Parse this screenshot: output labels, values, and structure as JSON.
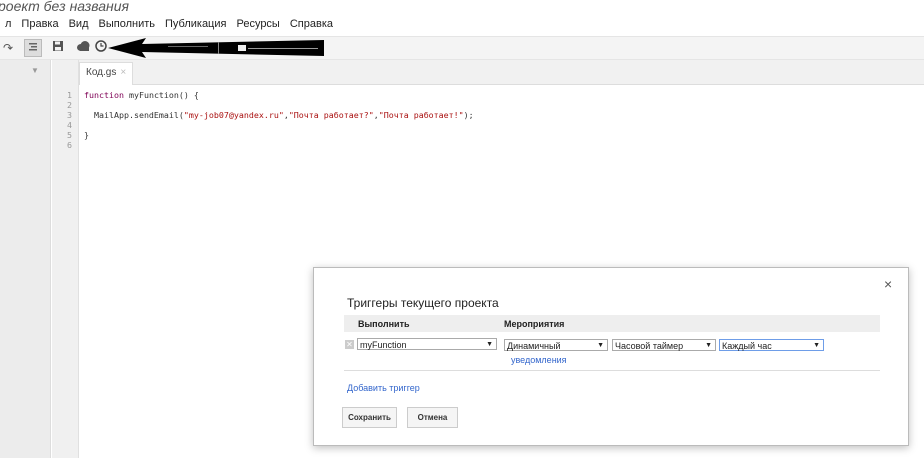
{
  "app": {
    "project_title": "роект без названия"
  },
  "menu": [
    "л",
    "Правка",
    "Вид",
    "Выполнить",
    "Публикация",
    "Ресурсы",
    "Справка"
  ],
  "toolbar": {
    "icons": [
      "redo-icon",
      "indent-icon",
      "save-icon",
      "cloud-icon",
      "timer-icon"
    ]
  },
  "editor": {
    "tab_label": "Код.gs",
    "line_numbers": [
      "1",
      "2",
      "3",
      "4",
      "5",
      "6"
    ],
    "lines": {
      "l1_kw": "function",
      "l1_rest": " myFunction() {",
      "l3_pre": "  MailApp.sendEmail(",
      "l3_s1": "\"my-job07@yandex.ru\"",
      "l3_sep1": ",",
      "l3_s2": "\"Почта работает?\"",
      "l3_sep2": ",",
      "l3_s3": "\"Почта работает!\"",
      "l3_end": ");",
      "l5": "}"
    }
  },
  "dialog": {
    "close_glyph": "×",
    "title": "Триггеры текущего проекта",
    "col_run": "Выполнить",
    "col_events": "Мероприятия",
    "trigger": {
      "function_value": "myFunction",
      "event_source": "Динамичный",
      "event_type": "Часовой таймер",
      "interval": "Каждый час",
      "notifications_link": "уведомления"
    },
    "add_trigger_link": "Добавить триггер",
    "save_button": "Сохранить",
    "cancel_button": "Отмена"
  }
}
